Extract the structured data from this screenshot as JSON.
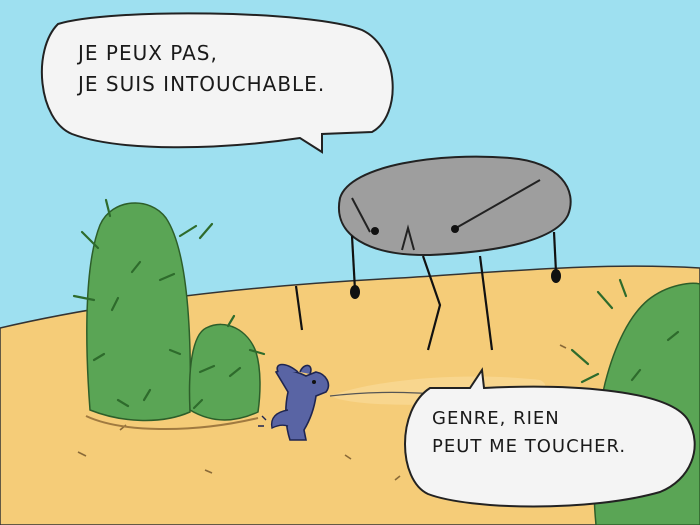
{
  "speech_top": {
    "line1": "Je peux pas,",
    "line2": "Je suis intouchable."
  },
  "speech_bottom": {
    "line1": "Genre, rien",
    "line2": "peut me toucher."
  },
  "colors": {
    "sky": "#9ee0f0",
    "sand": "#f5cc78",
    "sand_light": "#f8d68e",
    "cactus": "#5aa555",
    "rock": "#9e9e9e",
    "rabbit": "#5964a4",
    "bubble": "#f4f4f4"
  },
  "icons": [
    "cactus-icon",
    "rock-creature-icon",
    "rabbit-icon",
    "bush-icon"
  ]
}
